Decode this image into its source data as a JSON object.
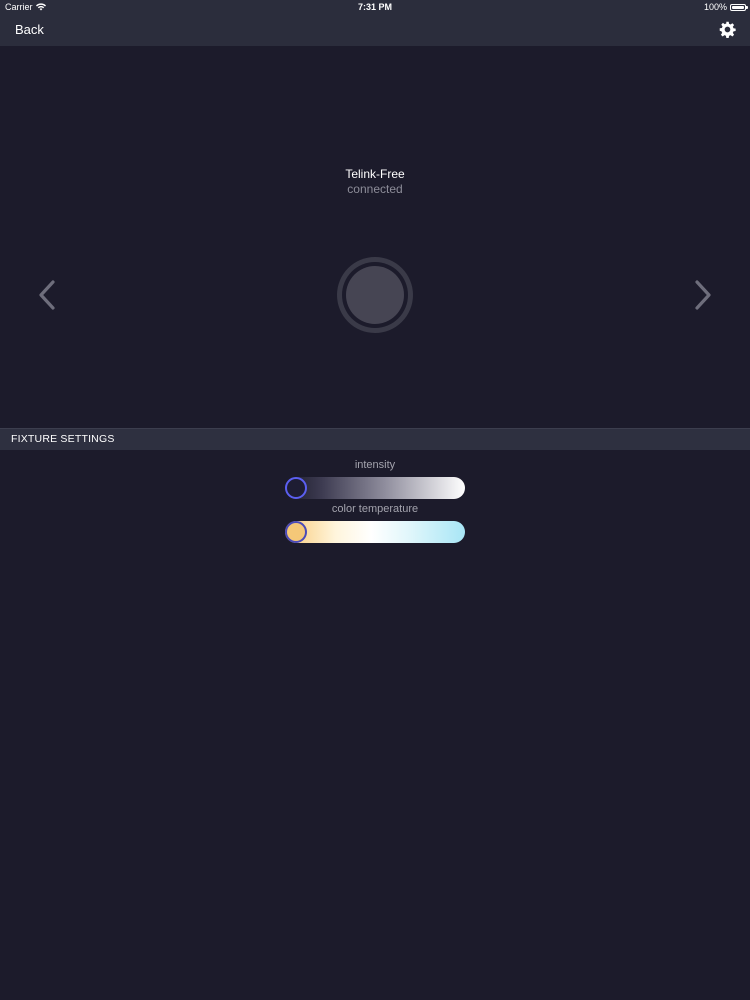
{
  "status_bar": {
    "carrier": "Carrier",
    "time": "7:31 PM",
    "battery": "100%"
  },
  "nav": {
    "back_label": "Back",
    "settings_icon": "gear-icon"
  },
  "device": {
    "name": "Telink-Free",
    "status": "connected",
    "prev_icon": "chevron-left-icon",
    "next_icon": "chevron-right-icon"
  },
  "fixture_settings": {
    "title": "FIXTURE SETTINGS",
    "sliders": [
      {
        "label": "intensity",
        "value": 0
      },
      {
        "label": "color temperature",
        "value": 0
      }
    ]
  },
  "colors": {
    "background": "#1c1b2b",
    "bar": "#2b2d3c",
    "thumb_border": "#5b5ff0"
  }
}
